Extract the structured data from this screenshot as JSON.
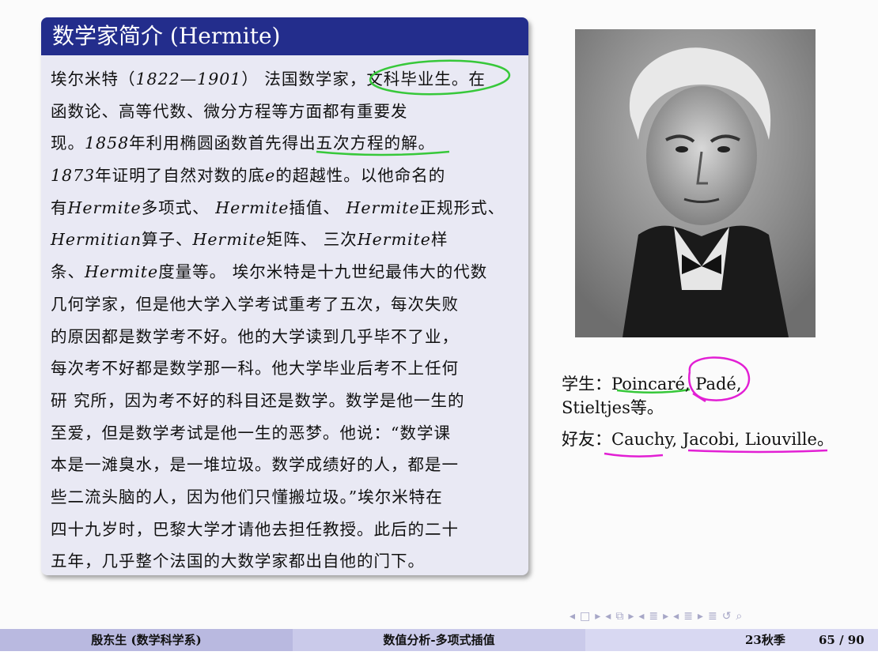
{
  "block": {
    "title": "数学家简介 (Hermite)",
    "lines": [
      {
        "segments": [
          {
            "t": "埃尔米特（",
            "i": false
          },
          {
            "t": "1822—1901",
            "i": true
          },
          {
            "t": "） 法国数学家，文科毕业生。在",
            "i": false
          }
        ]
      },
      {
        "segments": [
          {
            "t": "函数论、高等代数、微分方程等方面都有重要发",
            "i": false
          }
        ]
      },
      {
        "segments": [
          {
            "t": "现。",
            "i": false
          },
          {
            "t": "1858",
            "i": true
          },
          {
            "t": "年利用椭圆函数首先得出五次方程的解。",
            "i": false
          }
        ]
      },
      {
        "segments": [
          {
            "t": "1873",
            "i": true
          },
          {
            "t": "年证明了自然对数的底",
            "i": false
          },
          {
            "t": "e",
            "i": true
          },
          {
            "t": "的超越性。以他命名的",
            "i": false
          }
        ]
      },
      {
        "segments": [
          {
            "t": "有",
            "i": false
          },
          {
            "t": "Hermite",
            "i": true
          },
          {
            "t": "多项式、 ",
            "i": false
          },
          {
            "t": "Hermite",
            "i": true
          },
          {
            "t": "插值、 ",
            "i": false
          },
          {
            "t": "Hermite",
            "i": true
          },
          {
            "t": "正规形式、",
            "i": false
          }
        ]
      },
      {
        "segments": [
          {
            "t": "Hermitian",
            "i": true
          },
          {
            "t": "算子、",
            "i": false
          },
          {
            "t": "Hermite",
            "i": true
          },
          {
            "t": "矩阵、 三次",
            "i": false
          },
          {
            "t": "Hermite",
            "i": true
          },
          {
            "t": "样",
            "i": false
          }
        ]
      },
      {
        "segments": [
          {
            "t": "条、",
            "i": false
          },
          {
            "t": "Hermite",
            "i": true
          },
          {
            "t": "度量等。 埃尔米特是十九世纪最伟大的代数",
            "i": false
          }
        ]
      },
      {
        "segments": [
          {
            "t": "几何学家，但是他大学入学考试重考了五次，每次失败",
            "i": false
          }
        ]
      },
      {
        "segments": [
          {
            "t": "的原因都是数学考不好。他的大学读到几乎毕不了业，",
            "i": false
          }
        ]
      },
      {
        "segments": [
          {
            "t": "每次考不好都是数学那一科。他大学毕业后考不上任何",
            "i": false
          }
        ]
      },
      {
        "segments": [
          {
            "t": "研 究所，因为考不好的科目还是数学。数学是他一生的",
            "i": false
          }
        ]
      },
      {
        "segments": [
          {
            "t": "至爱，但是数学考试是他一生的恶梦。他说：“数学课",
            "i": false
          }
        ]
      },
      {
        "segments": [
          {
            "t": "本是一滩臭水，是一堆垃圾。数学成绩好的人，都是一",
            "i": false
          }
        ]
      },
      {
        "segments": [
          {
            "t": "些二流头脑的人，因为他们只懂搬垃圾。”埃尔米特在",
            "i": false
          }
        ]
      },
      {
        "segments": [
          {
            "t": "四十九岁时，巴黎大学才请他去担任教授。此后的二十",
            "i": false
          }
        ]
      },
      {
        "segments": [
          {
            "t": "五年，几乎整个法国的大数学家都出自他的门下。",
            "i": false
          }
        ]
      }
    ]
  },
  "side": {
    "students_line1": "学生：Poincaré, Padé,",
    "students_line2": "Stieltjes等。",
    "friends_line": "好友：Cauchy, Jacobi, Liouville。"
  },
  "nav": {
    "symbols": [
      "◂",
      "□",
      "▸",
      "◂",
      "⧉",
      "▸",
      "◂",
      "≣",
      "▸",
      "◂",
      "≣",
      "▸",
      "≣",
      "↺",
      "⌕"
    ]
  },
  "footer": {
    "author": "殷东生 (数学科学系)",
    "course": "数值分析-多项式插值",
    "semester": "23秋季",
    "page": "65 / 90"
  },
  "colors": {
    "block_title_bg": "#232d8c",
    "block_body_bg": "#e9e9f4",
    "green_annotation": "#37c83a",
    "magenta_annotation": "#e21fd4"
  }
}
